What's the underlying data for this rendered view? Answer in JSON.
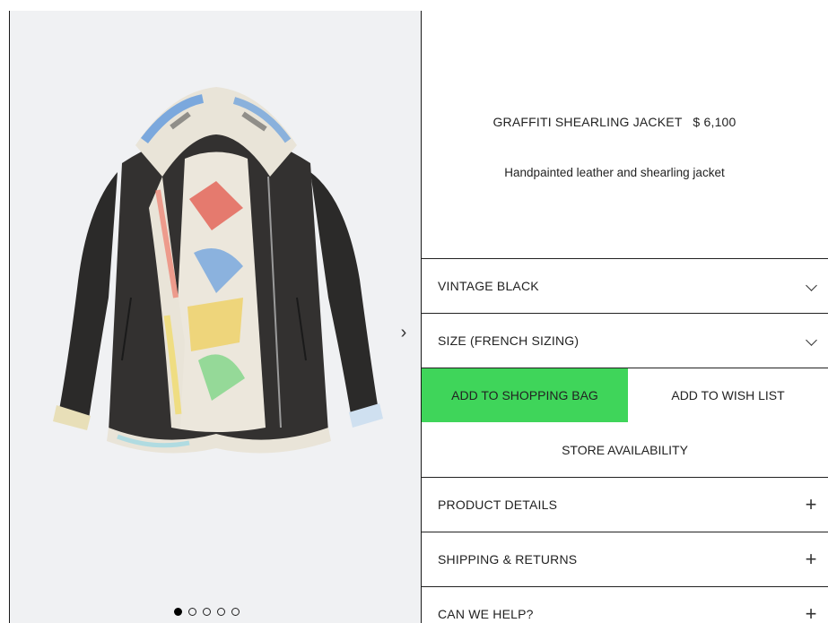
{
  "product": {
    "name": "GRAFFITI SHEARLING JACKET",
    "price": "$ 6,100",
    "description": "Handpainted leather and shearling jacket"
  },
  "gallery": {
    "next_arrow": "›",
    "dots_total": 5,
    "dots_active": 1
  },
  "options": {
    "color": "VINTAGE BLACK",
    "size": "SIZE (FRENCH SIZING)"
  },
  "actions": {
    "add_to_bag": "ADD TO SHOPPING BAG",
    "add_to_wishlist": "ADD TO WISH LIST",
    "store_availability": "STORE AVAILABILITY"
  },
  "accordions": [
    {
      "label": "PRODUCT DETAILS",
      "icon": "plus-icon"
    },
    {
      "label": "SHIPPING & RETURNS",
      "icon": "plus-icon"
    },
    {
      "label": "CAN WE HELP?",
      "icon": "plus-icon"
    }
  ],
  "colors": {
    "accent_green": "#3fd55a",
    "gallery_bg": "#f0f1f3",
    "border": "#222222"
  }
}
